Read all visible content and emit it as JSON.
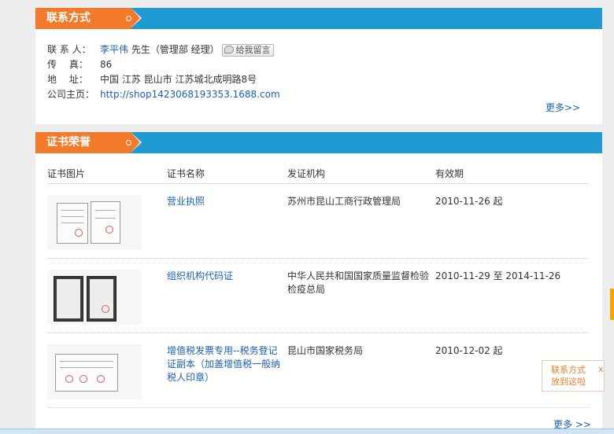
{
  "contact": {
    "title": "联系方式",
    "rows": [
      {
        "label": "联 系 人：",
        "name": "李平伟",
        "rest": " 先生（管理部 经理）"
      },
      {
        "label": "传　 真：",
        "value": "86"
      },
      {
        "label": "地　 址：",
        "value": "中国 江苏 昆山市 江苏城北成明路8号"
      },
      {
        "label": "公司主页：",
        "value": "http://shop1423068193353.1688.com"
      }
    ],
    "leave_message": "给我留言",
    "more": "更多>>"
  },
  "cert": {
    "title": "证书荣誉",
    "columns": [
      "证书图片",
      "证书名称",
      "发证机构",
      "有效期"
    ],
    "rows": [
      {
        "name": "营业执照",
        "issuer": "苏州市昆山工商行政管理局",
        "validity": "2010-11-26 起"
      },
      {
        "name": "组织机构代码证",
        "issuer": "中华人民共和国国家质量监督检验检疫总局",
        "validity": "2010-11-29 至 2014-11-26"
      },
      {
        "name": "增值税发票专用--税务登记证副本（加盖增值税一般纳税人印章）",
        "issuer": "昆山市国家税务局",
        "validity": "2010-12-02 起"
      }
    ],
    "more": "更多 >>"
  },
  "float_box": {
    "line1": "联系方式",
    "line2": "放到这啦",
    "close": "x"
  },
  "colors": {
    "accent_orange": "#f27a2a",
    "header_blue": "#1f9ad3",
    "link_blue": "#1a5fb4"
  }
}
